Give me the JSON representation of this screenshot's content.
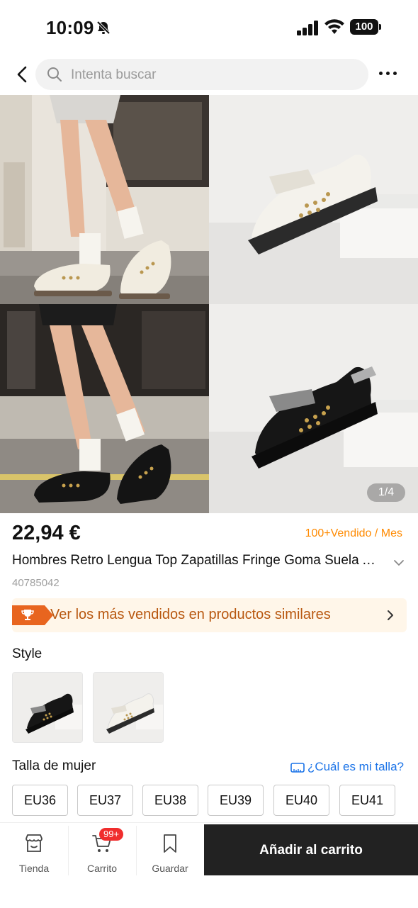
{
  "status_bar": {
    "time": "10:09",
    "battery": "100"
  },
  "header": {
    "search_placeholder": "Intenta buscar"
  },
  "gallery": {
    "counter": "1/4"
  },
  "product": {
    "price": "22,94 €",
    "sold": "100+Vendido / Mes",
    "title": "Hombres Retro Lengua Top Zapatillas Fringe Goma Suela Antideslizante",
    "sku": "40785042"
  },
  "bestsellers": {
    "label": "Ver los más vendidos en productos similares"
  },
  "style": {
    "label": "Style"
  },
  "size": {
    "label": "Talla de mujer",
    "guide": "¿Cuál es mi talla?",
    "options": [
      "EU36",
      "EU37",
      "EU38",
      "EU39",
      "EU40",
      "EU41"
    ]
  },
  "bottom_bar": {
    "store": "Tienda",
    "cart": "Carrito",
    "cart_badge": "99+",
    "save": "Guardar",
    "add_to_cart": "Añadir al carrito"
  },
  "colors": {
    "accent_orange": "#ff8a00",
    "brand_dark": "#222222",
    "link_blue": "#1a73e8",
    "badge_red": "#f02d2d"
  }
}
